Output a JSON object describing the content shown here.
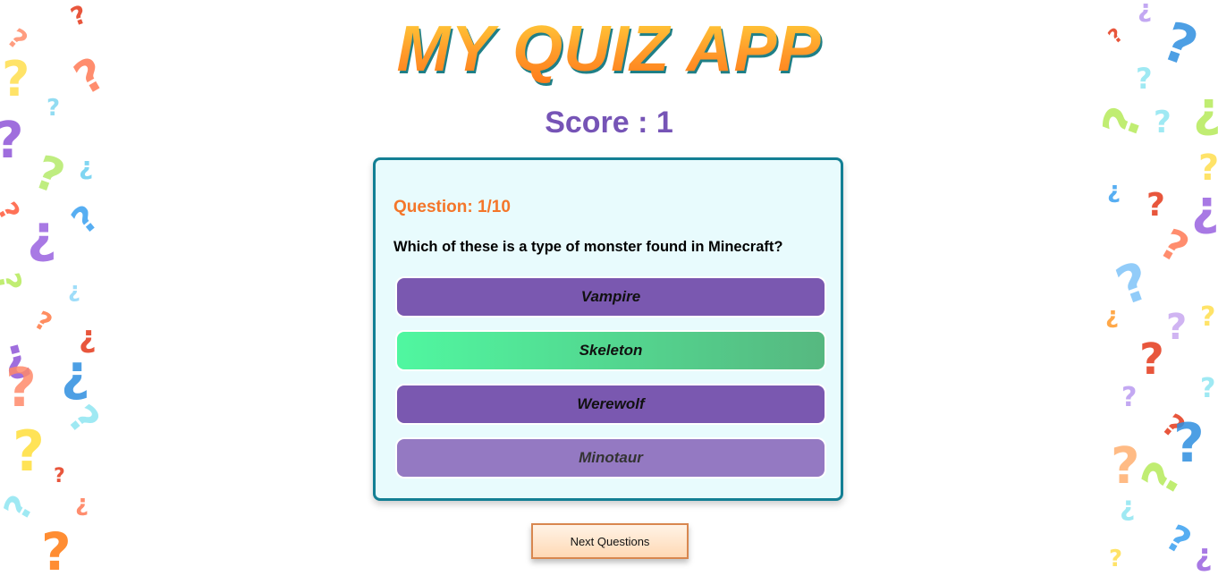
{
  "app": {
    "title": "MY QUIZ APP"
  },
  "score": {
    "label": "Score : 1"
  },
  "quiz": {
    "question_counter": "Question: 1/10",
    "question_text": "Which of these is a type of monster found in Minecraft?",
    "options": [
      {
        "label": "Vampire",
        "state": "default"
      },
      {
        "label": "Skeleton",
        "state": "correct"
      },
      {
        "label": "Werewolf",
        "state": "default"
      },
      {
        "label": "Minotaur",
        "state": "disabled"
      }
    ]
  },
  "actions": {
    "next_label": "Next Questions"
  },
  "colors": {
    "accent_purple": "#7654b6",
    "option_purple": "#7a58b0",
    "correct_green": "#50f7a0",
    "card_border": "#137f94",
    "counter_orange": "#f4762a"
  },
  "decor": {
    "icon": "question-mark-icon"
  }
}
